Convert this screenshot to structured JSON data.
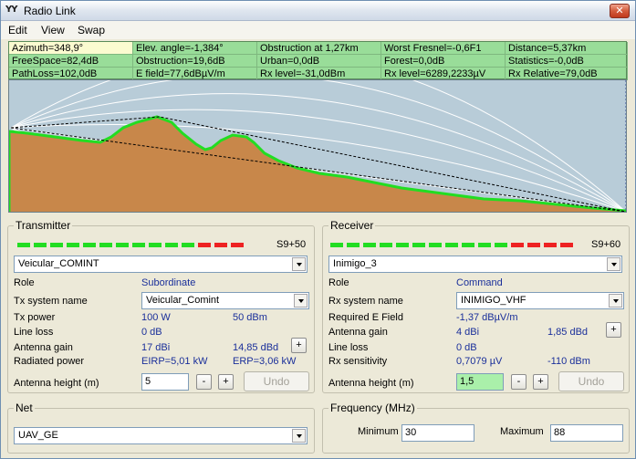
{
  "window": {
    "title": "Radio Link",
    "close_symbol": "✕",
    "icon_text": "YY"
  },
  "menu": {
    "items": [
      "Edit",
      "View",
      "Swap"
    ]
  },
  "info": {
    "rows": [
      [
        "Azimuth=348,9°",
        "Elev. angle=-1,384°",
        "Obstruction at 1,27km",
        "Worst Fresnel=-0,6F1",
        "Distance=5,37km"
      ],
      [
        "FreeSpace=82,4dB",
        "Obstruction=19,6dB",
        "Urban=0,0dB",
        "Forest=0,0dB",
        "Statistics=-0,0dB"
      ],
      [
        "PathLoss=102,0dB",
        "E field=77,6dBµV/m",
        "Rx level=-31,0dBm",
        "Rx level=6289,2233µV",
        "Rx Relative=79,0dB"
      ]
    ]
  },
  "transmitter": {
    "title": "Transmitter",
    "meter_label": "S9+50",
    "meter": {
      "green_segments": 11,
      "red_segments": 3
    },
    "unit": "Veicular_COMINT",
    "role_label": "Role",
    "role_value": "Subordinate",
    "system_label": "Tx system name",
    "system_value": "Veicular_Comint",
    "power_label": "Tx power",
    "power_w": "100 W",
    "power_dbm": "50 dBm",
    "loss_label": "Line loss",
    "loss_value": "0 dB",
    "gain_label": "Antenna gain",
    "gain_dbi": "17 dBi",
    "gain_dbd": "14,85 dBd",
    "radiated_label": "Radiated power",
    "eirp": "EIRP=5,01 kW",
    "erp": "ERP=3,06 kW",
    "height_label": "Antenna height (m)",
    "height_value": "5",
    "minus": "-",
    "plus": "+",
    "undo": "Undo"
  },
  "receiver": {
    "title": "Receiver",
    "meter_label": "S9+60",
    "meter": {
      "green_segments": 11,
      "red_segments": 4
    },
    "unit": "Inimigo_3",
    "role_label": "Role",
    "role_value": "Command",
    "system_label": "Rx system name",
    "system_value": "INIMIGO_VHF",
    "field_label": "Required E Field",
    "field_value": "-1,37 dBµV/m",
    "gain_label": "Antenna gain",
    "gain_dbi": "4 dBi",
    "gain_dbd": "1,85 dBd",
    "loss_label": "Line loss",
    "loss_value": "0 dB",
    "sens_label": "Rx sensitivity",
    "sens_uv": "0,7079 µV",
    "sens_dbm": "-110 dBm",
    "height_label": "Antenna height (m)",
    "height_value": "1,5",
    "minus": "-",
    "plus": "+",
    "undo": "Undo"
  },
  "net": {
    "title": "Net",
    "value": "UAV_GE"
  },
  "frequency": {
    "title": "Frequency (MHz)",
    "min_label": "Minimum",
    "min_value": "30",
    "max_label": "Maximum",
    "max_value": "88"
  },
  "colors": {
    "sky": "#b8ccd8",
    "terrain": "#c8874a",
    "terrain_edge": "#22dd22",
    "meter_green": "#22dd22",
    "meter_red": "#ee2222",
    "value_blue": "#1a2f9a"
  }
}
